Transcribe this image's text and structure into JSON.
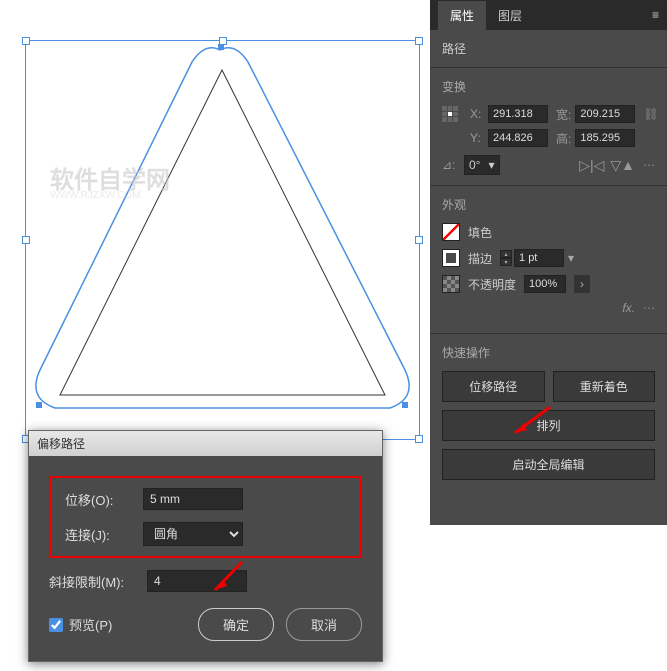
{
  "watermark": {
    "main": "软件自学网",
    "sub": "WWW.RJZXW.COM"
  },
  "panel": {
    "tabs": {
      "properties": "属性",
      "layers": "图层"
    },
    "path_label": "路径",
    "transform": {
      "title": "变换",
      "x_label": "X:",
      "x": "291.318",
      "w_label": "宽:",
      "w": "209.215",
      "y_label": "Y:",
      "y": "244.826",
      "h_label": "高:",
      "h": "185.295",
      "angle_label": "⊿:",
      "angle": "0°"
    },
    "appearance": {
      "title": "外观",
      "fill_label": "填色",
      "stroke_label": "描边",
      "stroke_value": "1 pt",
      "opacity_label": "不透明度",
      "opacity_value": "100%",
      "fx": "fx."
    },
    "quick": {
      "title": "快速操作",
      "offset_path": "位移路径",
      "recolor": "重新着色",
      "arrange": "排列",
      "global_edit": "启动全局编辑"
    }
  },
  "dialog": {
    "title": "偏移路径",
    "offset_label": "位移(O):",
    "offset_value": "5 mm",
    "join_label": "连接(J):",
    "join_value": "圆角",
    "miter_label": "斜接限制(M):",
    "miter_value": "4",
    "preview": "预览(P)",
    "ok": "确定",
    "cancel": "取消"
  }
}
